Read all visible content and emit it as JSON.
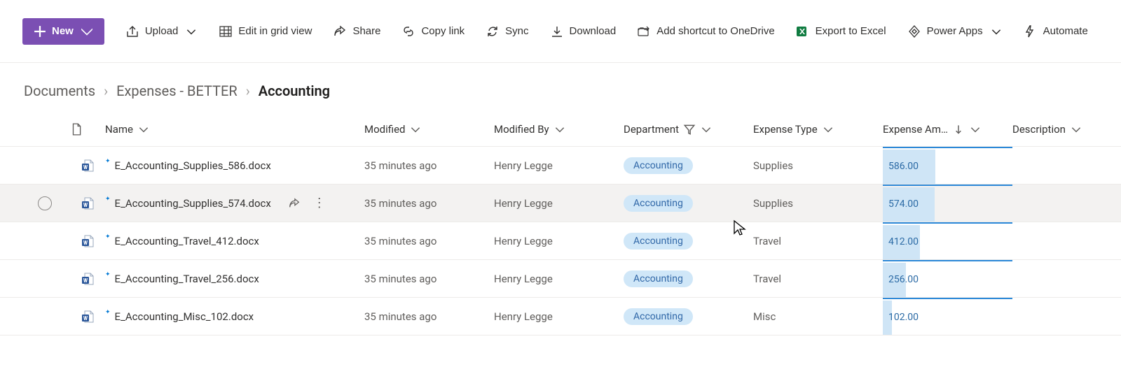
{
  "toolbar": {
    "new_label": "New",
    "upload_label": "Upload",
    "edit_grid_label": "Edit in grid view",
    "share_label": "Share",
    "copy_link_label": "Copy link",
    "sync_label": "Sync",
    "download_label": "Download",
    "add_shortcut_label": "Add shortcut to OneDrive",
    "export_excel_label": "Export to Excel",
    "power_apps_label": "Power Apps",
    "automate_label": "Automate"
  },
  "breadcrumb": {
    "items": [
      "Documents",
      "Expenses - BETTER"
    ],
    "current": "Accounting"
  },
  "columns": {
    "name": "Name",
    "modified": "Modified",
    "modified_by": "Modified By",
    "department": "Department",
    "expense_type": "Expense Type",
    "expense_amount": "Expense Am…",
    "description": "Description"
  },
  "amount_max": 586,
  "rows": [
    {
      "name": "E_Accounting_Supplies_586.docx",
      "modified": "35 minutes ago",
      "modified_by": "Henry Legge",
      "department": "Accounting",
      "expense_type": "Supplies",
      "amount": "586.00",
      "amount_pct": 100,
      "new": true,
      "hovered": false
    },
    {
      "name": "E_Accounting_Supplies_574.docx",
      "modified": "35 minutes ago",
      "modified_by": "Henry Legge",
      "department": "Accounting",
      "expense_type": "Supplies",
      "amount": "574.00",
      "amount_pct": 98,
      "new": true,
      "hovered": true
    },
    {
      "name": "E_Accounting_Travel_412.docx",
      "modified": "35 minutes ago",
      "modified_by": "Henry Legge",
      "department": "Accounting",
      "expense_type": "Travel",
      "amount": "412.00",
      "amount_pct": 70,
      "new": true,
      "hovered": false
    },
    {
      "name": "E_Accounting_Travel_256.docx",
      "modified": "35 minutes ago",
      "modified_by": "Henry Legge",
      "department": "Accounting",
      "expense_type": "Travel",
      "amount": "256.00",
      "amount_pct": 44,
      "new": true,
      "hovered": false
    },
    {
      "name": "E_Accounting_Misc_102.docx",
      "modified": "35 minutes ago",
      "modified_by": "Henry Legge",
      "department": "Accounting",
      "expense_type": "Misc",
      "amount": "102.00",
      "amount_pct": 17,
      "new": true,
      "hovered": false
    }
  ]
}
